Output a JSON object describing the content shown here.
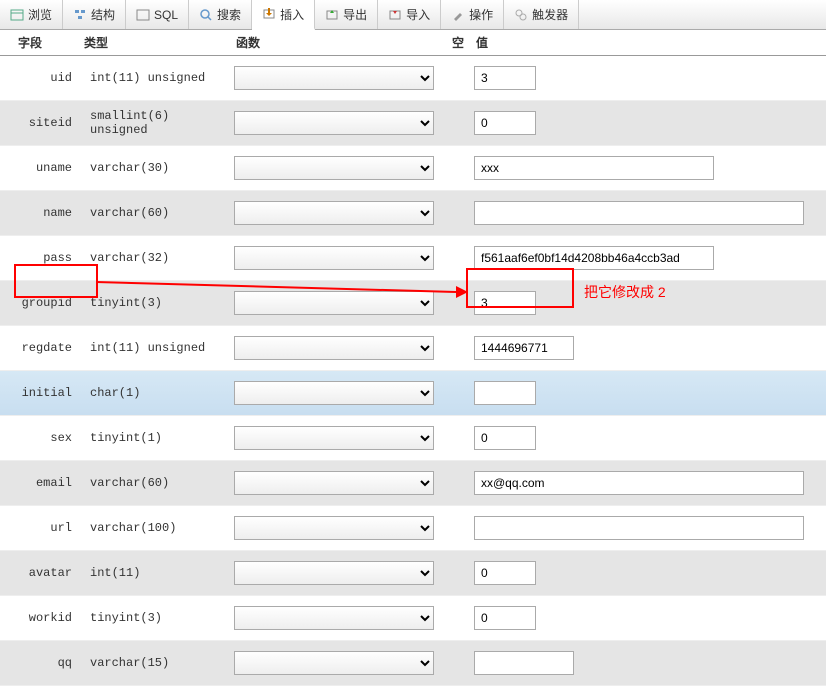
{
  "tabs": [
    {
      "label": "浏览",
      "icon": "browse"
    },
    {
      "label": "结构",
      "icon": "structure"
    },
    {
      "label": "SQL",
      "icon": "sql"
    },
    {
      "label": "搜索",
      "icon": "search"
    },
    {
      "label": "插入",
      "icon": "insert",
      "active": true
    },
    {
      "label": "导出",
      "icon": "export"
    },
    {
      "label": "导入",
      "icon": "import"
    },
    {
      "label": "操作",
      "icon": "operations"
    },
    {
      "label": "触发器",
      "icon": "trigger"
    }
  ],
  "headers": {
    "field": "字段",
    "type": "类型",
    "func": "函数",
    "null": "空",
    "value": "值"
  },
  "rows": [
    {
      "field": "uid",
      "type": "int(11) unsigned",
      "value": "3",
      "w": "short",
      "alt": false
    },
    {
      "field": "siteid",
      "type": "smallint(6) unsigned",
      "value": "0",
      "w": "short",
      "alt": true
    },
    {
      "field": "uname",
      "type": "varchar(30)",
      "value": "xxx",
      "w": "long",
      "alt": false
    },
    {
      "field": "name",
      "type": "varchar(60)",
      "value": "",
      "w": "full",
      "alt": true
    },
    {
      "field": "pass",
      "type": "varchar(32)",
      "value": "f561aaf6ef0bf14d4208bb46a4ccb3ad",
      "w": "long",
      "alt": false
    },
    {
      "field": "groupid",
      "type": "tinyint(3)",
      "value": "3",
      "w": "short",
      "alt": true
    },
    {
      "field": "regdate",
      "type": "int(11) unsigned",
      "value": "1444696771",
      "w": "med",
      "alt": false
    },
    {
      "field": "initial",
      "type": "char(1)",
      "value": "",
      "w": "short",
      "alt": false,
      "hl": true
    },
    {
      "field": "sex",
      "type": "tinyint(1)",
      "value": "0",
      "w": "short",
      "alt": false
    },
    {
      "field": "email",
      "type": "varchar(60)",
      "value": "xx@qq.com",
      "w": "full",
      "alt": true
    },
    {
      "field": "url",
      "type": "varchar(100)",
      "value": "",
      "w": "full",
      "alt": false
    },
    {
      "field": "avatar",
      "type": "int(11)",
      "value": "0",
      "w": "short",
      "alt": true
    },
    {
      "field": "workid",
      "type": "tinyint(3)",
      "value": "0",
      "w": "short",
      "alt": false
    },
    {
      "field": "qq",
      "type": "varchar(15)",
      "value": "",
      "w": "med",
      "alt": true
    }
  ],
  "annotation": {
    "text": "把它修改成 2"
  }
}
